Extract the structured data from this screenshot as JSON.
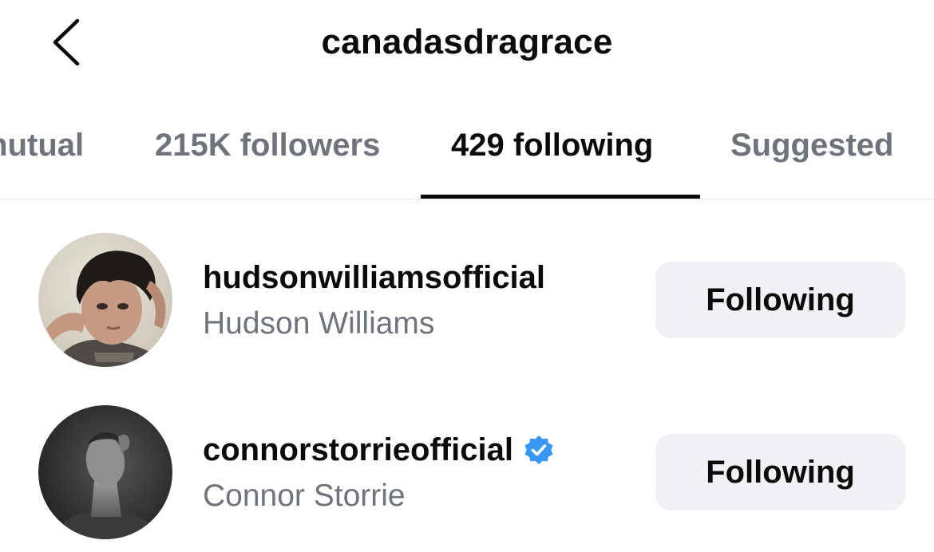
{
  "header": {
    "title": "canadasdragrace",
    "back_icon": "chevron-left-icon"
  },
  "tabs": [
    {
      "label": "mutual",
      "active": false
    },
    {
      "label": "215K followers",
      "active": false
    },
    {
      "label": "429 following",
      "active": true
    },
    {
      "label": "Suggested",
      "active": false
    }
  ],
  "accounts": [
    {
      "username": "hudsonwilliamsofficial",
      "full_name": "Hudson Williams",
      "verified": false,
      "button_label": "Following"
    },
    {
      "username": "connorstorrieofficial",
      "full_name": "Connor Storrie",
      "verified": true,
      "button_label": "Following"
    }
  ],
  "colors": {
    "primary_text": "#0b0b0b",
    "secondary_text": "#6e737c",
    "button_bg": "#eff1f4",
    "verified_blue": "#3897f0",
    "divider": "#e6e6e6"
  }
}
